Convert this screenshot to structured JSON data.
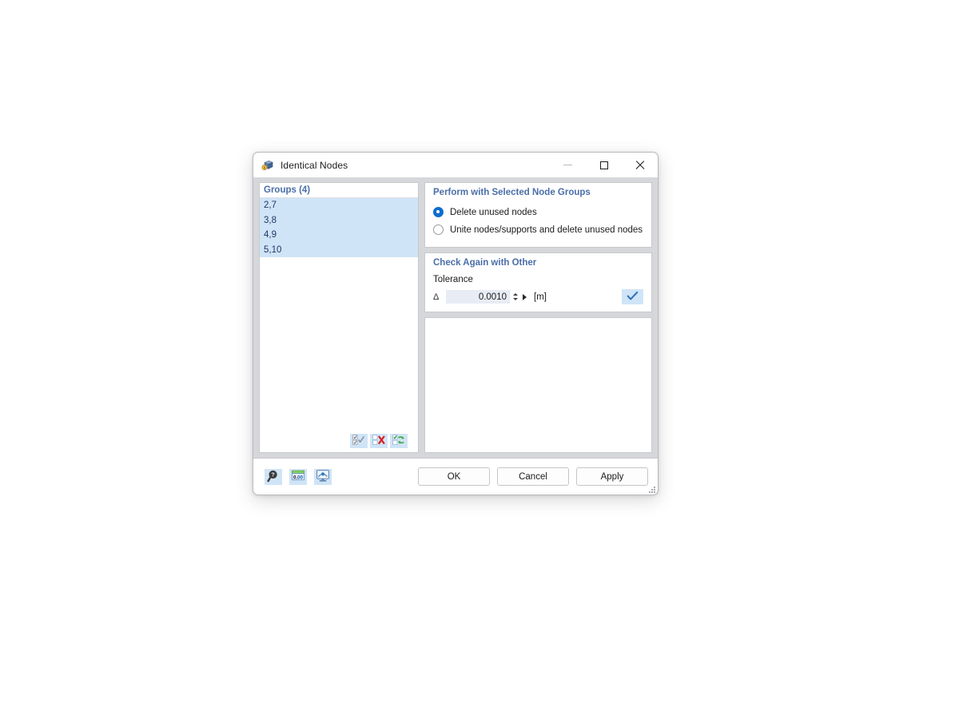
{
  "window": {
    "title": "Identical Nodes",
    "icon": "node-cube-icon",
    "controls": {
      "minimize": "minimize-icon",
      "maximize": "maximize-icon",
      "close": "close-icon"
    }
  },
  "groups_panel": {
    "header": "Groups (4)",
    "rows": [
      "2,7",
      "3,8",
      "4,9",
      "5,10"
    ],
    "toolbar": [
      {
        "name": "select-all-button",
        "icon": "checkmarks-icon",
        "title": "Select All"
      },
      {
        "name": "deselect-all-button",
        "icon": "red-x-icon",
        "title": "Deselect All"
      },
      {
        "name": "invert-selection-button",
        "icon": "green-refresh-icon",
        "title": "Invert Selection"
      }
    ]
  },
  "perform_box": {
    "title": "Perform with Selected Node Groups",
    "options": [
      {
        "label": "Delete unused nodes",
        "checked": true
      },
      {
        "label": "Unite nodes/supports and delete unused nodes",
        "checked": false
      }
    ]
  },
  "check_box": {
    "title": "Check Again with Other",
    "tolerance_label": "Tolerance",
    "delta_symbol": "Δ",
    "tolerance_value": "0.0010",
    "unit": "[m]",
    "apply_check_icon": "check-icon"
  },
  "footer": {
    "tools": [
      {
        "name": "help-button",
        "icon": "help-magnifier-icon"
      },
      {
        "name": "units-button",
        "icon": "units-decimal-icon"
      },
      {
        "name": "display-properties-button",
        "icon": "display-monitor-icon"
      }
    ],
    "buttons": [
      {
        "label": "OK",
        "name": "ok-button"
      },
      {
        "label": "Cancel",
        "name": "cancel-button"
      },
      {
        "label": "Apply",
        "name": "apply-button"
      }
    ]
  },
  "colors": {
    "accent_header": "#4a6ea8",
    "selection": "#cfe4f7",
    "radio_active": "#0d6ccf",
    "dialog_bg": "#d6d7da"
  }
}
